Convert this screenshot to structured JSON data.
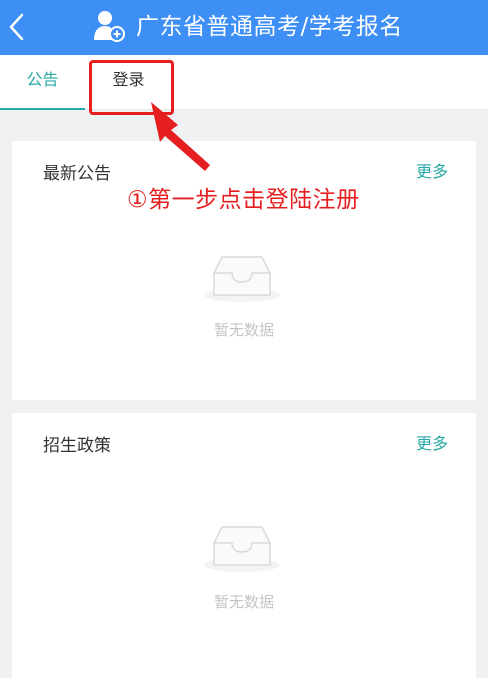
{
  "header": {
    "title": "广东省普通高考/学考报名",
    "back_icon": "chevron-left-icon",
    "user_icon": "user-add-icon",
    "background": "#3d8ff5"
  },
  "tabs": [
    {
      "label": "公告",
      "active": true
    },
    {
      "label": "登录",
      "active": false
    }
  ],
  "annotation": {
    "text": "①第一步点击登陆注册",
    "color": "#e51f1f"
  },
  "sections": [
    {
      "title": "最新公告",
      "more_label": "更多",
      "empty_text": "暂无数据"
    },
    {
      "title": "招生政策",
      "more_label": "更多",
      "empty_text": "暂无数据"
    }
  ],
  "accent_color": "#27a8a8"
}
